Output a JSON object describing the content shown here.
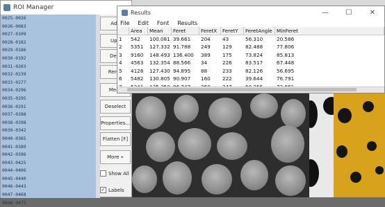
{
  "roi_manager": {
    "title": "ROI Manager",
    "items": [
      "0025-0026",
      "0026-0083",
      "0027-0109",
      "0028-0182",
      "0029-0186",
      "0030-0192",
      "0031-0203",
      "0032-0239",
      "0033-0277",
      "0034-0296",
      "0035-0295",
      "0036-0291",
      "0037-0288",
      "0038-0298",
      "0039-0342",
      "0040-0365",
      "0041-0389",
      "0042-0396",
      "0043-0425",
      "0044-0406",
      "0045-0440",
      "0046-0443",
      "0047-0468",
      "0048-0472"
    ],
    "buttons": [
      "Add",
      "Upd",
      "Dele",
      "Renar",
      "Meas",
      "Deselect",
      "Properties...",
      "Flatten [F]",
      "More »"
    ],
    "show_all_label": "Show All",
    "show_all_checked": false,
    "labels_label": "Labels",
    "labels_checked": true
  },
  "results": {
    "title": "Results",
    "menu": [
      "File",
      "Edit",
      "Font",
      "Results"
    ],
    "window_controls": {
      "minimize": "—",
      "maximize": "☐",
      "close": "✕"
    },
    "columns": [
      "",
      "Area",
      "Mean",
      "Feret",
      "FeretX",
      "FeretY",
      "FeretAngle",
      "MinFeret"
    ],
    "rows": [
      [
        "1",
        "542",
        "100.081",
        "39.661",
        "204",
        "43",
        "56.310",
        "20.586"
      ],
      [
        "2",
        "5351",
        "127.332",
        "91.788",
        "249",
        "129",
        "82.488",
        "77.806"
      ],
      [
        "3",
        "9160",
        "148.493",
        "136.400",
        "389",
        "175",
        "73.824",
        "85.813"
      ],
      [
        "4",
        "4563",
        "132.354",
        "88.566",
        "34",
        "226",
        "83.517",
        "67.448"
      ],
      [
        "5",
        "4128",
        "127.430",
        "94.895",
        "88",
        "233",
        "82.126",
        "56.695"
      ],
      [
        "6",
        "5482",
        "130.805",
        "90.907",
        "160",
        "222",
        "39.644",
        "76.791"
      ],
      [
        "7",
        "5341",
        "135.350",
        "96.747",
        "250",
        "247",
        "60.255",
        "72.861"
      ]
    ]
  }
}
